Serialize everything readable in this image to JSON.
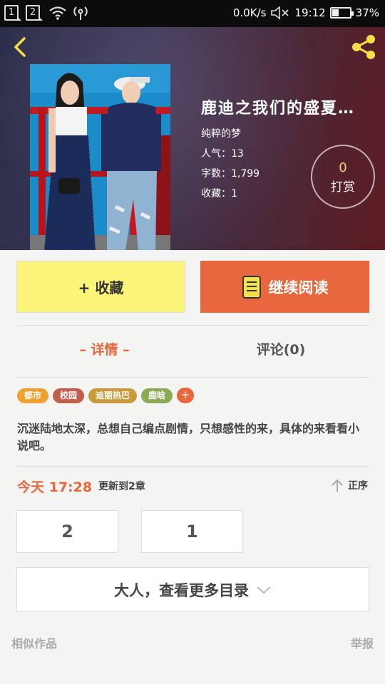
{
  "status_bar": {
    "sim1": "1",
    "sim2": "2",
    "net_speed": "0.0K/s",
    "time": "19:12",
    "battery": "37%",
    "battery_level": 0.37
  },
  "header": {
    "book_title": "鹿迪之我们的盛夏…",
    "author": "纯粹的梦",
    "popularity": "人气：13",
    "word_count": "字数：1,799",
    "favorites": "收藏：1",
    "tip_count": "0",
    "tip_label": "打赏"
  },
  "actions": {
    "favorite_label": "+ 收藏",
    "read_label": "继续阅读"
  },
  "tabs": {
    "detail": "– 详情 –",
    "comments": "评论(0)"
  },
  "tags": [
    {
      "label": "都市",
      "color": "#f0a030"
    },
    {
      "label": "校园",
      "color": "#c0604c"
    },
    {
      "label": "迪丽热巴",
      "color": "#c89a3c"
    },
    {
      "label": "鹿晗",
      "color": "#8aab54"
    }
  ],
  "tag_add": "+",
  "synopsis": "沉迷陆地太深，总想自己编点剧情，只想感性的来，具体的来看看小说吧。",
  "update": {
    "today": "今天 17:28",
    "text": "更新到2章",
    "sort_label": "正序"
  },
  "chapters": [
    "2",
    "1"
  ],
  "more_label": "大人，查看更多目录",
  "footer": {
    "similar": "相似作品",
    "report": "举报"
  },
  "colors": {
    "accent": "#e9673c",
    "favorite_bg": "#fbf57a"
  }
}
